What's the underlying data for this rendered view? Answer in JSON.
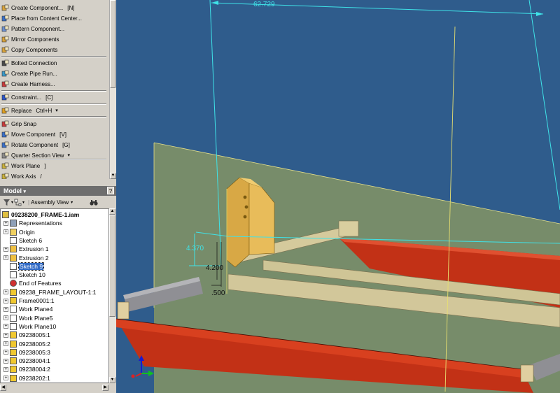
{
  "commands": [
    {
      "label": "Create Component...",
      "shortcut": "[N]",
      "icon": "create-component-icon"
    },
    {
      "label": "Place from Content Center...",
      "shortcut": "",
      "icon": "content-center-icon"
    },
    {
      "label": "Pattern Component...",
      "shortcut": "",
      "icon": "pattern-component-icon"
    },
    {
      "label": "Mirror Components",
      "shortcut": "",
      "icon": "mirror-components-icon"
    },
    {
      "label": "Copy Components",
      "shortcut": "",
      "icon": "copy-components-icon"
    },
    {
      "label": "Bolted Connection",
      "shortcut": "",
      "icon": "bolted-connection-icon"
    },
    {
      "label": "Create Pipe Run...",
      "shortcut": "",
      "icon": "pipe-run-icon"
    },
    {
      "label": "Create Harness...",
      "shortcut": "",
      "icon": "harness-icon"
    },
    {
      "label": "Constraint...",
      "shortcut": "[C]",
      "icon": "constraint-icon"
    },
    {
      "label": "Replace",
      "shortcut": "Ctrl+H",
      "icon": "replace-icon"
    },
    {
      "label": "Grip Snap",
      "shortcut": "",
      "icon": "grip-snap-icon"
    },
    {
      "label": "Move Component",
      "shortcut": "[V]",
      "icon": "move-component-icon"
    },
    {
      "label": "Rotate Component",
      "shortcut": "[G]",
      "icon": "rotate-component-icon"
    },
    {
      "label": "Quarter Section View",
      "shortcut": "",
      "icon": "section-view-icon"
    },
    {
      "label": "Work Plane",
      "shortcut": "]",
      "icon": "work-plane-icon"
    },
    {
      "label": "Work Axis",
      "shortcut": "/",
      "icon": "work-axis-icon"
    }
  ],
  "browser": {
    "title": "Model",
    "help": "?",
    "view_mode": "Assembly View",
    "filter_icon": "filter-icon",
    "find_icon": "binoculars-icon"
  },
  "tree": [
    {
      "label": "09238200_FRAME-1.iam",
      "expand": "",
      "icon": "assembly-icon",
      "bold": true
    },
    {
      "label": "Representations",
      "expand": "+",
      "icon": "representations-icon"
    },
    {
      "label": "Origin",
      "expand": "+",
      "icon": "folder-icon"
    },
    {
      "label": "Sketch 6",
      "expand": "",
      "icon": "sketch-icon"
    },
    {
      "label": "Extrusion 1",
      "expand": "+",
      "icon": "extrusion-icon"
    },
    {
      "label": "Extrusion 2",
      "expand": "+",
      "icon": "extrusion-icon"
    },
    {
      "label": "Sketch 9",
      "expand": "",
      "icon": "sketch-icon",
      "selected": true
    },
    {
      "label": "Sketch 10",
      "expand": "",
      "icon": "sketch-icon"
    },
    {
      "label": "End of Features",
      "expand": "",
      "icon": "end-of-features-icon"
    },
    {
      "label": "09238_FRAME_LAYOUT-1:1",
      "expand": "+",
      "icon": "part-icon"
    },
    {
      "label": "Frame0001:1",
      "expand": "+",
      "icon": "part-icon"
    },
    {
      "label": "Work Plane4",
      "expand": "+",
      "icon": "work-plane-icon"
    },
    {
      "label": "Work Plane5",
      "expand": "+",
      "icon": "work-plane-icon"
    },
    {
      "label": "Work Plane10",
      "expand": "+",
      "icon": "work-plane-icon"
    },
    {
      "label": "09238005:1",
      "expand": "+",
      "icon": "part-icon"
    },
    {
      "label": "09238005:2",
      "expand": "+",
      "icon": "part-icon"
    },
    {
      "label": "09238005:3",
      "expand": "+",
      "icon": "part-icon"
    },
    {
      "label": "09238004:1",
      "expand": "+",
      "icon": "part-icon"
    },
    {
      "label": "09238004:2",
      "expand": "+",
      "icon": "part-icon"
    },
    {
      "label": "09238202:1",
      "expand": "+",
      "icon": "part-icon"
    }
  ],
  "viewport": {
    "dimensions": {
      "width": "62.729",
      "height": "4.370",
      "offset": "4.200",
      "thickness": ".500"
    },
    "colors": {
      "background": "#2f5c8c",
      "dimension": "#3fe3e8",
      "plane": "#8a9a5a",
      "beam": "#c23116",
      "rail": "#d2c79a",
      "tube": "#8f8f94",
      "plate": "#d8a845"
    },
    "triad": "coordinate-triad-icon"
  }
}
